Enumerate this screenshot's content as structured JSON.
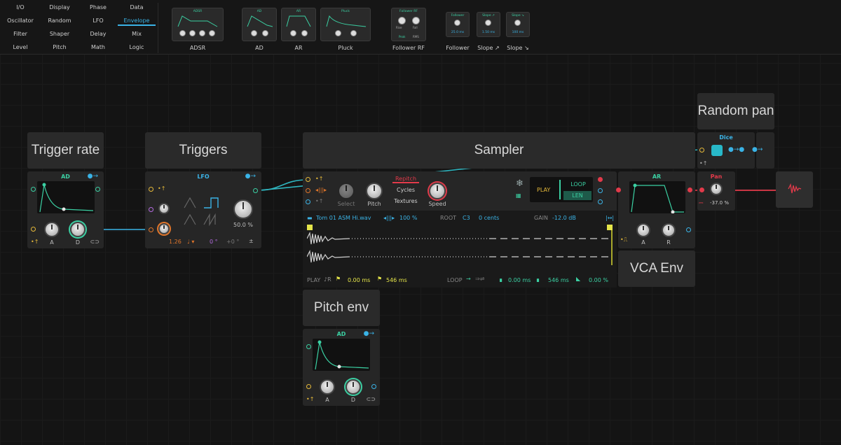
{
  "categories": [
    [
      "I/O",
      "Display",
      "Phase",
      "Data"
    ],
    [
      "Oscillator",
      "Random",
      "LFO",
      "Envelope"
    ],
    [
      "Filter",
      "Shaper",
      "Delay",
      "Mix"
    ],
    [
      "Level",
      "Pitch",
      "Math",
      "Logic"
    ]
  ],
  "active_category": "Envelope",
  "browser_items": [
    {
      "label": "ADSR",
      "mini_title": "ADSR",
      "knobs": [
        "A",
        "D",
        "S",
        "R"
      ]
    },
    {
      "label": "AD",
      "mini_title": "AD",
      "knobs": [
        "A",
        "D"
      ]
    },
    {
      "label": "AR",
      "mini_title": "AR",
      "knobs": [
        "A",
        "R"
      ]
    },
    {
      "label": "Pluck",
      "mini_title": "Pluck",
      "knobs": [
        "D",
        "R"
      ]
    },
    {
      "label": "Follower RF",
      "mini_title": "Follower RF",
      "knobs": [
        "Rise",
        "Fall"
      ],
      "extra": [
        "Peak",
        "RMS"
      ]
    },
    {
      "label": "Follower",
      "mini_title": "Follower",
      "value": "25.0 ms"
    },
    {
      "label": "Slope ↗",
      "mini_title": "Slope ↗",
      "value": "1.50 ms"
    },
    {
      "label": "Slope ↘",
      "mini_title": "Slope ↘",
      "value": "100 ms"
    }
  ],
  "cards": {
    "trigger_rate": "Trigger rate",
    "triggers": "Triggers",
    "sampler": "Sampler",
    "random_pan": "Random pan",
    "pitch_env": "Pitch env",
    "vca_env": "VCA Env"
  },
  "ad1": {
    "title": "AD",
    "a": "A",
    "d": "D"
  },
  "lfo": {
    "title": "LFO",
    "amount": "50.0 %",
    "rate": "1.26",
    "phase": "0 °",
    "offset": "+0 °",
    "plus_minus": "±"
  },
  "sampler": {
    "mode": "Repitch",
    "modes": [
      "Cycles",
      "Textures"
    ],
    "knobs": [
      "Select",
      "Pitch",
      "Speed"
    ],
    "play": "PLAY",
    "loop": "LOOP",
    "len": "LEN",
    "file": "Tom 01 ASM Hi.wav",
    "amount": "100 %",
    "root_label": "ROOT",
    "root": "C3",
    "cents": "0 cents",
    "gain_label": "GAIN",
    "gain": "-12.0 dB",
    "play_label": "PLAY",
    "start": "0.00 ms",
    "end": "546 ms",
    "loop_label": "LOOP",
    "loop_start": "0.00 ms",
    "loop_end": "546 ms",
    "loop_fade": "0.00 %"
  },
  "ar": {
    "title": "AR",
    "a": "A",
    "r": "R"
  },
  "dice": {
    "title": "Dice"
  },
  "pan": {
    "title": "Pan",
    "value": "-37.0 %"
  },
  "ad2": {
    "title": "AD",
    "a": "A",
    "d": "D"
  },
  "colors": {
    "teal": "#3bd0a3",
    "blue": "#3ab3e6",
    "orange": "#e0752a",
    "yellow": "#e5b93a",
    "red": "#e23a4a",
    "purple": "#b46be0"
  }
}
